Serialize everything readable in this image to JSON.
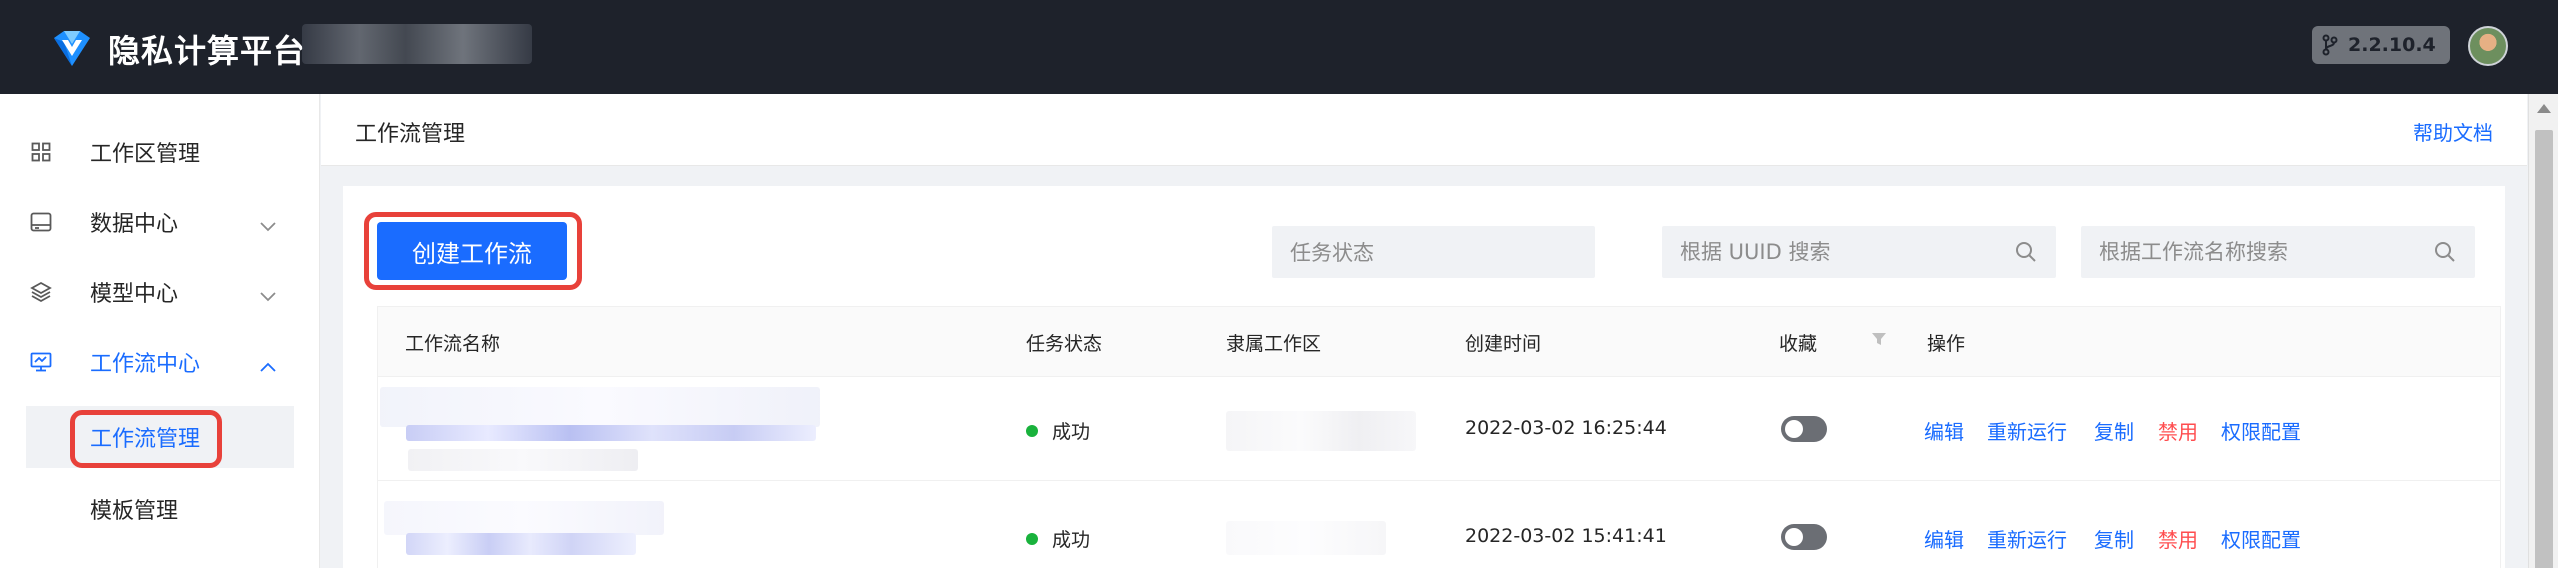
{
  "app": {
    "title": "隐私计算平台",
    "version": "2.2.10.4"
  },
  "sidebar": {
    "items": [
      {
        "label": "工作区管理",
        "icon": "grid-icon"
      },
      {
        "label": "数据中心",
        "icon": "database-icon"
      },
      {
        "label": "模型中心",
        "icon": "layers-icon"
      },
      {
        "label": "工作流中心",
        "icon": "monitor-icon"
      }
    ],
    "sub_items": [
      {
        "label": "工作流管理"
      },
      {
        "label": "模板管理"
      }
    ]
  },
  "page": {
    "title": "工作流管理",
    "help": "帮助文档"
  },
  "toolbar": {
    "create_label": "创建工作流",
    "status_placeholder": "任务状态",
    "uuid_placeholder": "根据 UUID 搜索",
    "name_placeholder": "根据工作流名称搜索"
  },
  "table": {
    "columns": [
      "工作流名称",
      "任务状态",
      "隶属工作区",
      "创建时间",
      "收藏",
      "操作"
    ],
    "rows": [
      {
        "status": "成功",
        "created": "2022-03-02 16:25:44",
        "favorite": false
      },
      {
        "status": "成功",
        "created": "2022-03-02 15:41:41",
        "favorite": false
      }
    ],
    "actions": [
      "编辑",
      "重新运行",
      "复制",
      "禁用",
      "权限配置"
    ]
  },
  "colors": {
    "primary": "#1a6cff",
    "danger": "#ff4d4f",
    "success": "#19b23c",
    "highlight": "#e8413a",
    "topbar": "#1e222b"
  }
}
